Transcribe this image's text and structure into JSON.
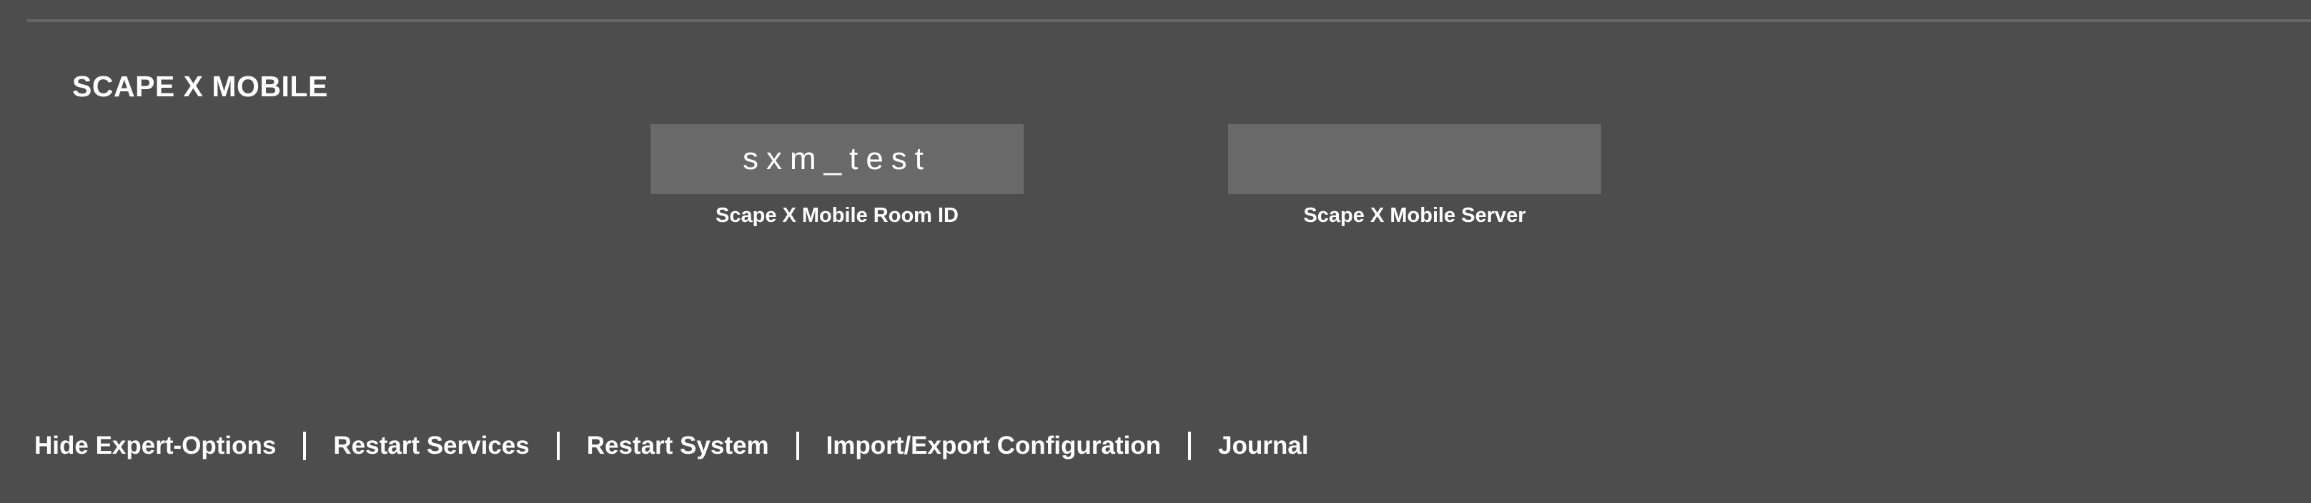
{
  "section": {
    "title": "SCAPE X MOBILE"
  },
  "fields": {
    "room_id": {
      "value": "sxm_test",
      "label": "Scape X Mobile Room ID"
    },
    "server": {
      "value": "",
      "label": "Scape X Mobile Server"
    }
  },
  "footer": {
    "links": [
      "Hide Expert-Options",
      "Restart Services",
      "Restart System",
      "Import/Export Configuration",
      "Journal"
    ]
  },
  "colors": {
    "background": "#4d4d4d",
    "field_background": "#696969",
    "text": "#ffffff",
    "rule": "#666666"
  }
}
